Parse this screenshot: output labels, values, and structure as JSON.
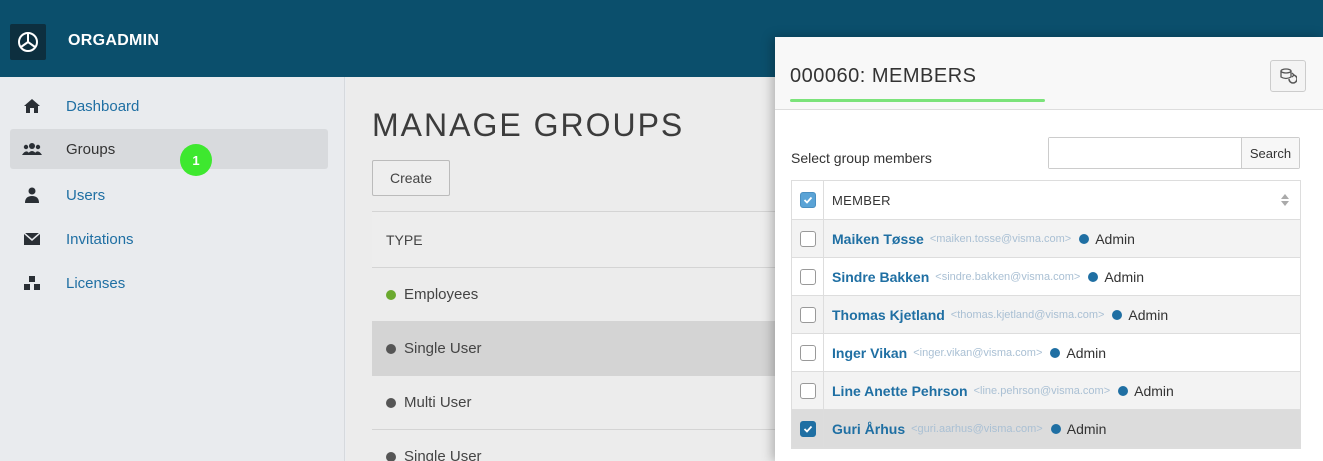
{
  "app": {
    "title": "ORGADMIN"
  },
  "sidebar": {
    "items": [
      {
        "label": "Dashboard",
        "icon": "home-icon"
      },
      {
        "label": "Groups",
        "icon": "users-icon",
        "active": true
      },
      {
        "label": "Users",
        "icon": "user-icon"
      },
      {
        "label": "Invitations",
        "icon": "envelope-icon"
      },
      {
        "label": "Licenses",
        "icon": "cubes-icon"
      }
    ],
    "badge": "1"
  },
  "main": {
    "title": "MANAGE GROUPS",
    "create_label": "Create",
    "column_type": "TYPE",
    "rows": [
      {
        "label": "Employees",
        "dot_color": "#6aa92e"
      },
      {
        "label": "Single User",
        "dot_color": "#555555"
      },
      {
        "label": "Multi User",
        "dot_color": "#555555"
      },
      {
        "label": "Single User",
        "dot_color": "#555555"
      }
    ]
  },
  "panel": {
    "title": "000060: MEMBERS",
    "select_label": "Select group members",
    "search_placeholder": "",
    "search_label": "Search",
    "column_member": "MEMBER",
    "members": [
      {
        "name": "Maiken Tøsse",
        "email": "<maiken.tosse@visma.com>",
        "role": "Admin",
        "checked": false
      },
      {
        "name": "Sindre Bakken",
        "email": "<sindre.bakken@visma.com>",
        "role": "Admin",
        "checked": false
      },
      {
        "name": "Thomas Kjetland",
        "email": "<thomas.kjetland@visma.com>",
        "role": "Admin",
        "checked": false
      },
      {
        "name": "Inger Vikan",
        "email": "<inger.vikan@visma.com>",
        "role": "Admin",
        "checked": false
      },
      {
        "name": "Line Anette Pehrson",
        "email": "<line.pehrson@visma.com>",
        "role": "Admin",
        "checked": false
      },
      {
        "name": "Guri Århus",
        "email": "<guri.aarhus@visma.com>",
        "role": "Admin",
        "checked": true
      }
    ]
  },
  "colors": {
    "topbar": "#0b4f6c",
    "link": "#1f6fa3",
    "badge": "#3ee82f",
    "underline": "#7be37a"
  }
}
